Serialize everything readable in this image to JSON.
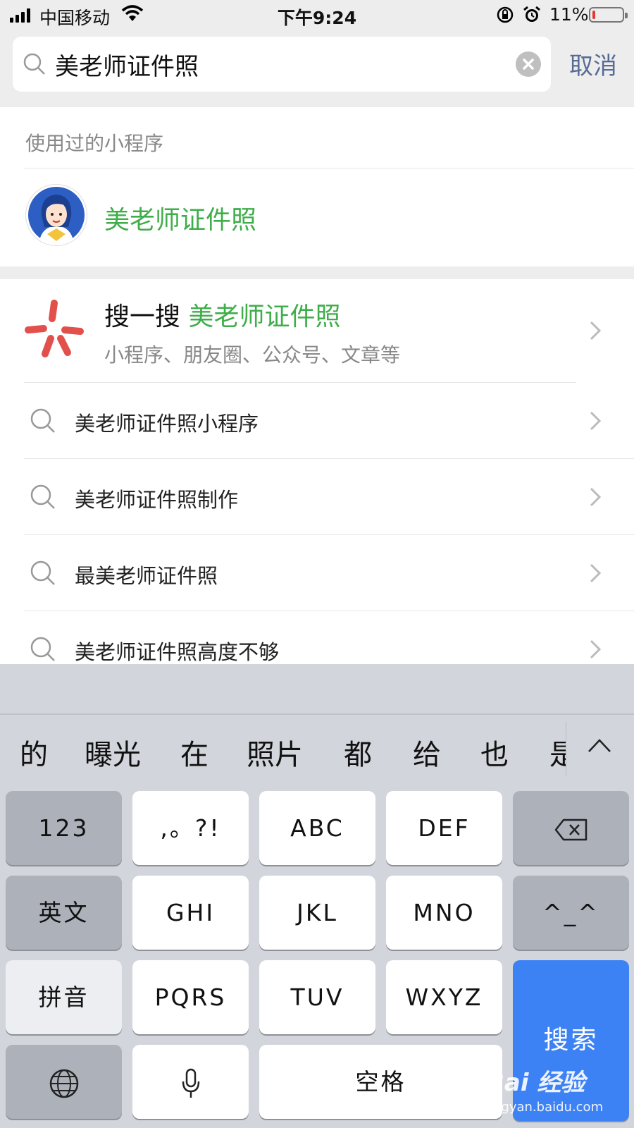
{
  "status_bar": {
    "carrier": "中国移动",
    "time": "下午9:24",
    "battery_percent": "11%",
    "battery_level": 0.11,
    "icons": [
      "signal-icon",
      "wifi-icon",
      "rotation-lock-icon",
      "alarm-icon",
      "battery-icon"
    ]
  },
  "search": {
    "query": "美老师证件照",
    "cancel_label": "取消"
  },
  "used_miniprograms": {
    "header": "使用过的小程序",
    "items": [
      {
        "name": "美老师证件照",
        "icon": "teacher-avatar-icon"
      }
    ]
  },
  "sousou": {
    "prefix": "搜一搜",
    "keyword": "美老师证件照",
    "description": "小程序、朋友圈、公众号、文章等",
    "icon": "sousou-logo-icon"
  },
  "suggestions": [
    "美老师证件照小程序",
    "美老师证件照制作",
    "最美老师证件照",
    "美老师证件照高度不够"
  ],
  "keyboard": {
    "candidates": [
      "的",
      "曝光",
      "在",
      "照片",
      "都",
      "给",
      "也",
      "是"
    ],
    "rows": [
      [
        "123",
        ",。?!",
        "ABC",
        "DEF",
        "delete"
      ],
      [
        "英文",
        "GHI",
        "JKL",
        "MNO",
        "^_^"
      ],
      [
        "拼音",
        "PQRS",
        "TUV",
        "WXYZ"
      ],
      [
        "globe",
        "mic",
        "空格"
      ]
    ],
    "search_key": "搜索"
  },
  "watermark": {
    "brand": "Bai 经验",
    "url": "jingyan.baidu.com"
  },
  "colors": {
    "accent_green": "#3fae4a",
    "cancel_blue": "#576b95",
    "search_key_blue": "#3d82f5",
    "battery_red": "#e53935"
  }
}
